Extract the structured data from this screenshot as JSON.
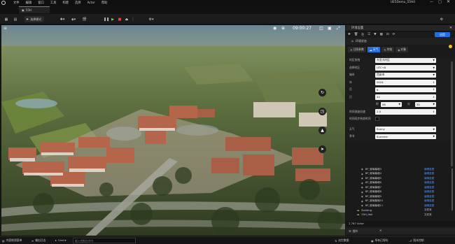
{
  "title_bar": {
    "menu": [
      "文件",
      "编辑",
      "窗口",
      "工具",
      "构建",
      "选择",
      "Actor",
      "帮助"
    ],
    "project": "UE5Demo_55H4"
  },
  "tab_bar": {
    "level_tab": "55H"
  },
  "toolbar": {
    "mode": "选择模式"
  },
  "viewport": {
    "time": "09:00:27"
  },
  "panel": {
    "title": "环境设置",
    "search_placeholder": "搜索",
    "apply_button": "应用",
    "env_label": "环境状态",
    "tabs": [
      "日照参数",
      "天气",
      "特效",
      "对象"
    ],
    "props": {
      "region_label": "时区系统",
      "region_value": "东亚大时区",
      "tz_label": "选择时区",
      "tz_value": "UTC+8",
      "city_label": "城市",
      "city_value": "西安市",
      "year_label": "年",
      "year_value": "2024",
      "month_label": "月",
      "month_value": "6",
      "day_label": "日",
      "day_value": "22",
      "hour_label": "时",
      "hour_value": "06",
      "min_label": "分",
      "min_value": "30",
      "speed_label": "时间流逝倍速",
      "speed_value": "2.0",
      "realtime_label": "时间同步系统时间",
      "weather_label": "天气",
      "weather_value": "Sunny",
      "season_label": "季节",
      "season_value": "Summer"
    },
    "outline_items": [
      {
        "name": "BP_玻璃幕墙3",
        "type": "编辑蓝图"
      },
      {
        "name": "BP_玻璃幕墙4",
        "type": "编辑蓝图"
      },
      {
        "name": "BP_玻璃幕墙5",
        "type": "编辑蓝图"
      },
      {
        "name": "BP_玻璃幕墙6",
        "type": "编辑蓝图"
      },
      {
        "name": "BP_玻璃幕墙7",
        "type": "编辑蓝图"
      },
      {
        "name": "BP_玻璃幕墙8",
        "type": "编辑蓝图"
      },
      {
        "name": "BP_玻璃幕墙9",
        "type": "编辑蓝图"
      },
      {
        "name": "BP_玻璃幕墙10",
        "type": "编辑蓝图"
      },
      {
        "name": "BP_玻璃幕墙11",
        "type": "编辑蓝图"
      },
      {
        "name": "Building",
        "type": "文件夹"
      },
      {
        "name": "55H_Hall",
        "type": "文件夹"
      }
    ],
    "actor_count": "2,767 Actor",
    "details_tab": "细节"
  },
  "status_bar": {
    "content_drawer": "内容侧滑菜单",
    "output_log": "输出日志",
    "cmd": "Cmd",
    "cmd_placeholder": "输入控制台命令",
    "derived": "派生数据",
    "unsaved": "所有已保存",
    "source_control": "版本控制"
  },
  "colors": {
    "accent": "#3a86ff",
    "bg": "#1a1a1a",
    "viewport_sky": "#6f8895"
  }
}
